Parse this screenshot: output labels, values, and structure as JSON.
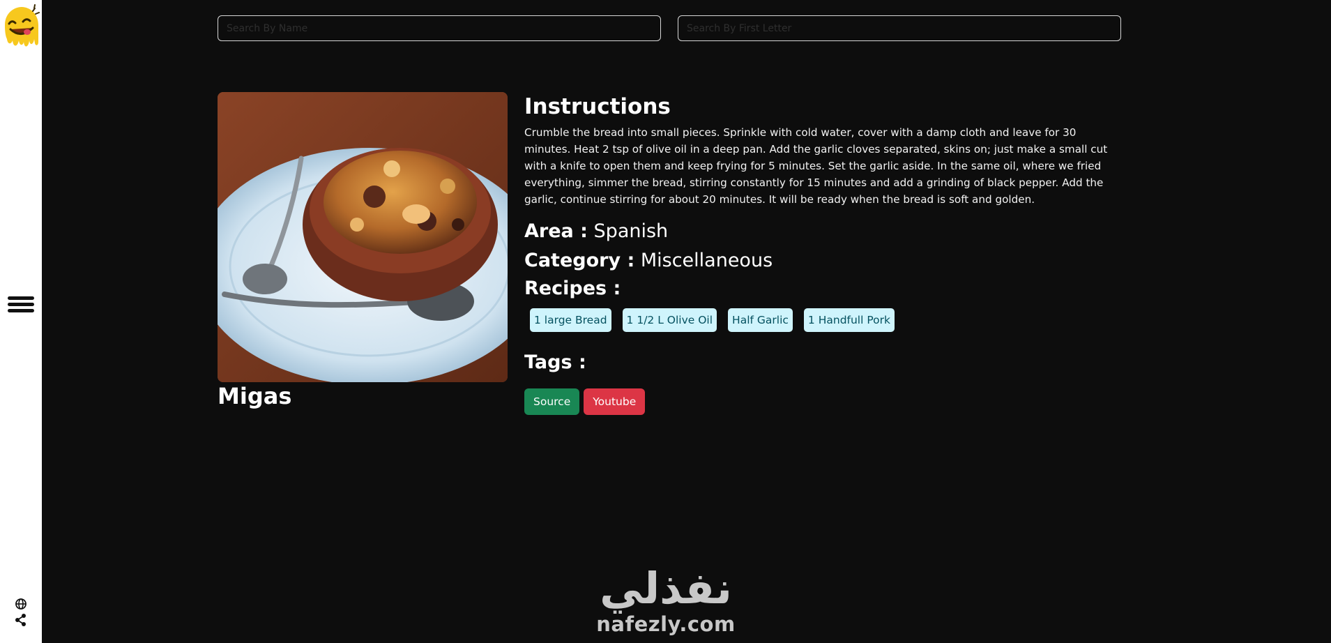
{
  "sidebar": {
    "logo_icon": "smiley-face-logo-icon",
    "menu_icon": "hamburger-menu-icon",
    "bottom_icons": [
      "globe-icon",
      "share-icon"
    ]
  },
  "search": {
    "by_name_placeholder": "Search By Name",
    "by_letter_placeholder": "Search By First Letter"
  },
  "meal": {
    "name": "Migas",
    "image_alt": "Migas",
    "instructions_heading": "Instructions",
    "instructions": "Crumble the bread into small pieces. Sprinkle with cold water, cover with a damp cloth and leave for 30 minutes. Heat 2 tsp of olive oil in a deep pan. Add the garlic cloves separated, skins on; just make a small cut with a knife to open them and keep frying for 5 minutes. Set the garlic aside. In the same oil, where we fried everything, simmer the bread, stirring constantly for 15 minutes and add a grinding of black pepper. Add the garlic, continue stirring for about 20 minutes. It will be ready when the bread is soft and golden.",
    "area_label": "Area :",
    "area": "Spanish",
    "category_label": "Category :",
    "category": "Miscellaneous",
    "recipes_label": "Recipes :",
    "recipes": [
      "1 large Bread",
      "1 1/2 L Olive Oil",
      "Half Garlic",
      "1 Handfull Pork"
    ],
    "tags_label": "Tags :",
    "source_label": "Source",
    "youtube_label": "Youtube"
  },
  "brand": {
    "arabic": "نفذلي",
    "domain": "nafezly.com"
  },
  "colors": {
    "background": "#0d0d0d",
    "sidebar": "#ffffff",
    "chip_bg": "#cff4fc",
    "chip_text": "#055160",
    "source_btn": "#198754",
    "youtube_btn": "#dc3545"
  }
}
